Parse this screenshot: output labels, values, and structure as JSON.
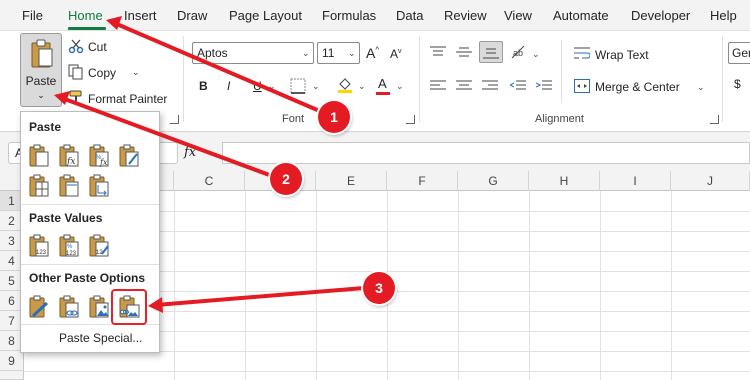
{
  "menu": {
    "items": [
      "File",
      "Home",
      "Insert",
      "Draw",
      "Page Layout",
      "Formulas",
      "Data",
      "Review",
      "View",
      "Automate",
      "Developer",
      "Help"
    ],
    "active": "Home"
  },
  "clipboard": {
    "paste_label": "Paste",
    "cut_label": "Cut",
    "copy_label": "Copy",
    "format_painter_label": "Format Painter"
  },
  "font": {
    "font_name": "Aptos",
    "font_size": "11",
    "group_label": "Font"
  },
  "alignment": {
    "wrap_text_label": "Wrap Text",
    "merge_center_label": "Merge & Center",
    "group_label": "Alignment"
  },
  "number": {
    "format_value": "Ger"
  },
  "formula_bar": {
    "name_box_visible": "A",
    "fx_label": "fx"
  },
  "grid": {
    "columns": [
      "C",
      "D",
      "E",
      "F",
      "G",
      "H",
      "I",
      "J"
    ],
    "rows": [
      "1",
      "2",
      "3",
      "4",
      "5",
      "6",
      "7",
      "8",
      "9"
    ]
  },
  "paste_menu": {
    "section_paste": "Paste",
    "section_paste_values": "Paste Values",
    "section_other": "Other Paste Options",
    "paste_special_label": "Paste Special..."
  },
  "annotations": {
    "callouts": [
      "1",
      "2",
      "3"
    ],
    "accent_color": "#e41b23"
  },
  "colors": {
    "excel_green": "#107c41",
    "highlight_yellow": "#ffd700",
    "font_red": "#e41b23"
  }
}
